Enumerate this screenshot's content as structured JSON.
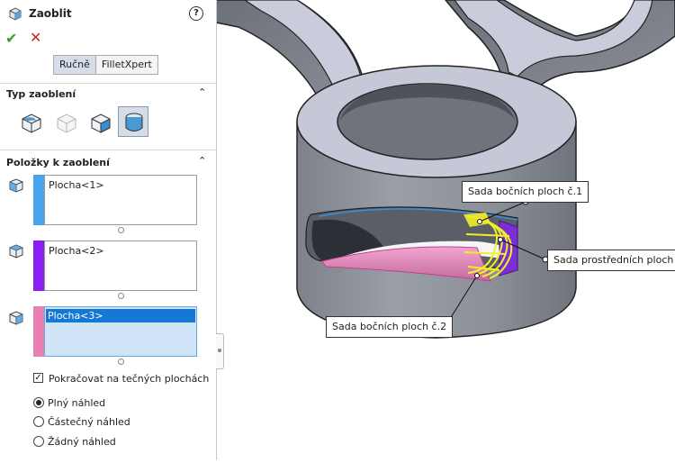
{
  "header": {
    "title": "Zaoblit",
    "help_glyph": "?"
  },
  "actions": {
    "ok_glyph": "✔",
    "cancel_glyph": "✕"
  },
  "tabs": [
    {
      "label": "Ručně",
      "active": true
    },
    {
      "label": "FilletXpert",
      "active": false
    }
  ],
  "fillet_type": {
    "title": "Typ zaoblení",
    "collapse_glyph": "⌃"
  },
  "items": {
    "title": "Položky k zaoblení",
    "collapse_glyph": "⌃",
    "lists": [
      {
        "value": "Plocha<1>",
        "color": "#4aa3ef"
      },
      {
        "value": "Plocha<2>",
        "color": "#8b1ef5"
      },
      {
        "value": "Plocha<3>",
        "color": "#ea7fb3"
      }
    ]
  },
  "options": {
    "tangent": {
      "label": "Pokračovat na tečných plochách",
      "checked": true,
      "glyph": "✓"
    },
    "preview": [
      {
        "label": "Plný náhled",
        "selected": true
      },
      {
        "label": "Částečný náhled",
        "selected": false
      },
      {
        "label": "Žádný náhled",
        "selected": false
      }
    ]
  },
  "callouts": {
    "side1": "Sada bočních ploch č.1",
    "middle": "Sada prostředních ploch",
    "side2": "Sada bočních ploch č.2"
  },
  "colors": {
    "part_gray": "#8f939b",
    "part_top": "#c5c8d6",
    "accent_blue": "#1577d6",
    "fillet_yellow": "#f2ee2a"
  }
}
